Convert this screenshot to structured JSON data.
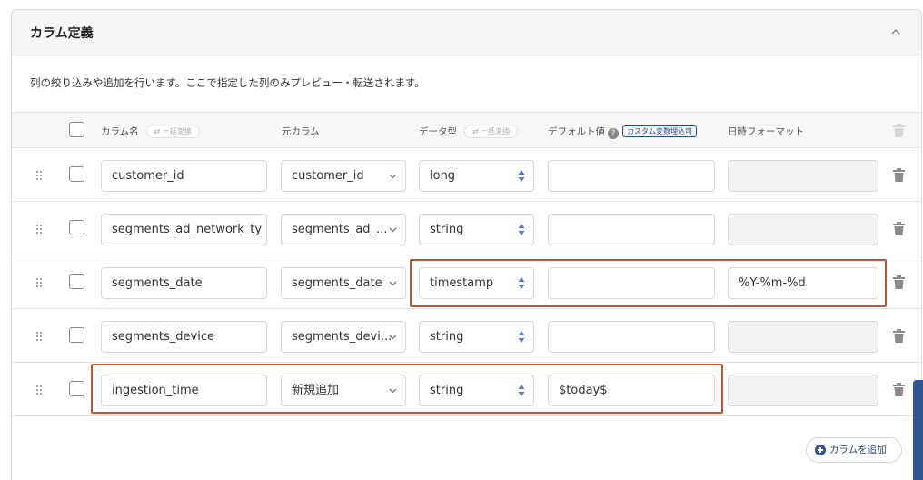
{
  "panel": {
    "title": "カラム定義",
    "description": "列の絞り込みや追加を行います。ここで指定した列のみプレビュー・転送されます。"
  },
  "table": {
    "headers": {
      "column_name": "カラム名",
      "column_name_bulk": "一括変換",
      "source_column": "元カラム",
      "data_type": "データ型",
      "data_type_bulk": "一括変換",
      "default_value": "デフォルト値",
      "custom_var_badge": "カスタム変数埋込可",
      "datetime_format": "日時フォーマット"
    },
    "rows": [
      {
        "name": "customer_id",
        "source": "customer_id",
        "type": "long",
        "default": "",
        "format": "",
        "format_enabled": false
      },
      {
        "name": "segments_ad_network_ty",
        "source": "segments_ad_...",
        "type": "string",
        "default": "",
        "format": "",
        "format_enabled": false
      },
      {
        "name": "segments_date",
        "source": "segments_date",
        "type": "timestamp",
        "default": "",
        "format": "%Y-%m-%d",
        "format_enabled": true
      },
      {
        "name": "segments_device",
        "source": "segments_devi...",
        "type": "string",
        "default": "",
        "format": "",
        "format_enabled": false
      },
      {
        "name": "ingestion_time",
        "source": "新規追加",
        "type": "string",
        "default": "$today$",
        "format": "",
        "format_enabled": false
      }
    ]
  },
  "add_button": {
    "label": "カラムを追加"
  },
  "colors": {
    "highlight": "#c8512e",
    "accent": "#2f5597"
  }
}
